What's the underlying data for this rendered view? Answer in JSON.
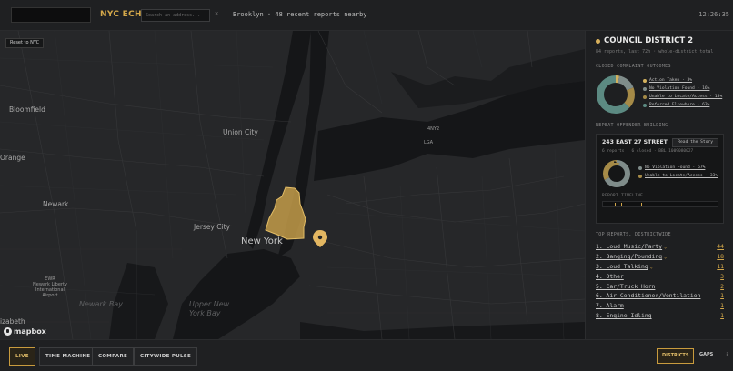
{
  "header": {
    "brand": "NYC ECHO",
    "search_placeholder": "Search an address...",
    "clear": "×",
    "status": "Brooklyn · 48 recent reports nearby",
    "time": "12:26:35"
  },
  "map": {
    "reset_label": "Reset to NYC",
    "attribution": "mapbox",
    "labels": {
      "bloomfield": "Bloomfield",
      "union_city": "Union City",
      "orange": "Orange",
      "newark": "Newark",
      "jersey_city": "Jersey City",
      "new_york": "New York",
      "nyc_abbr": "4NY2",
      "lga": "LGA",
      "ewr": "EWR\nNewark Liberty\nInternational\nAirport",
      "newark_bay": "Newark Bay",
      "upper_bay": "Upper New\nYork Bay",
      "elizabeth": "izabeth"
    },
    "colors": {
      "district_fill": "#d4a84a",
      "pin": "#e2b661"
    }
  },
  "panel": {
    "title": "COUNCIL DISTRICT 2",
    "subtitle": "84 reports, last 72h · whole-district total",
    "closed_heading": "CLOSED COMPLAINT OUTCOMES",
    "outcomes": [
      {
        "label": "Action Taken · 3%",
        "value": 3,
        "color": "#d4b25e"
      },
      {
        "label": "No Violation Found · 16%",
        "value": 16,
        "color": "#7f8c8a"
      },
      {
        "label": "Unable to Locate/Access · 18%",
        "value": 18,
        "color": "#a58a47"
      },
      {
        "label": "Referred Elsewhere · 63%",
        "value": 63,
        "color": "#5c8a82"
      }
    ],
    "repeat_heading": "REPEAT OFFENDER BUILDING",
    "repeat": {
      "address": "243 EAST 27 STREET",
      "story_button": "Read the Story",
      "meta": "6 reports · 6 closed · BBL 1009080027",
      "outcomes": [
        {
          "label": "No Violation Found · 67%",
          "value": 67,
          "color": "#7f8c8a"
        },
        {
          "label": "Unable to Locate/Access · 33%",
          "value": 33,
          "color": "#a58a47"
        }
      ],
      "timeline_heading": "REPORT TIMELINE",
      "timeline_ticks": [
        0.1,
        0.16,
        0.33
      ]
    },
    "top_heading": "TOP REPORTS, DISTRICTWIDE",
    "top_reports": [
      {
        "name": "1. Loud Music/Party",
        "count": "44",
        "chev": true
      },
      {
        "name": "2. Banging/Pounding",
        "count": "18",
        "chev": true
      },
      {
        "name": "3. Loud Talking",
        "count": "11",
        "chev": true
      },
      {
        "name": "4. Other",
        "count": "3",
        "chev": false
      },
      {
        "name": "5. Car/Truck Horn",
        "count": "2",
        "chev": false
      },
      {
        "name": "6. Air Conditioner/Ventilation",
        "count": "1",
        "chev": false
      },
      {
        "name": "7. Alarm",
        "count": "1",
        "chev": false
      },
      {
        "name": "8. Engine Idling",
        "count": "1",
        "chev": false
      }
    ]
  },
  "footer": {
    "modes": [
      "LIVE",
      "TIME MACHINE",
      "COMPARE",
      "CITYWIDE PULSE"
    ],
    "districts": "DISTRICTS",
    "gaps": "GAPS",
    "info": "i"
  }
}
